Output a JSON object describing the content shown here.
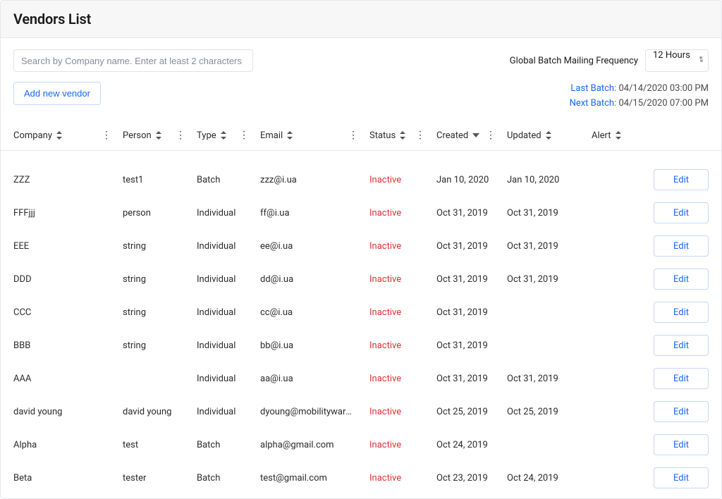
{
  "header": {
    "title": "Vendors List"
  },
  "search": {
    "placeholder": "Search by Company name. Enter at least 2 characters"
  },
  "frequency": {
    "label": "Global Batch Mailing Frequency",
    "value": "12 Hours"
  },
  "add_button": "Add new vendor",
  "batch": {
    "last_label": "Last Batch:",
    "last_value": "04/14/2020 03:00 PM",
    "next_label": "Next Batch:",
    "next_value": "04/15/2020 07:00 PM"
  },
  "columns": {
    "company": "Company",
    "person": "Person",
    "type": "Type",
    "email": "Email",
    "status": "Status",
    "created": "Created",
    "updated": "Updated",
    "alert": "Alert"
  },
  "edit_label": "Edit",
  "rows": [
    {
      "company": "ZZZ",
      "person": "test1",
      "type": "Batch",
      "email": "zzz@i.ua",
      "status": "Inactive",
      "created": "Jan 10, 2020",
      "updated": "Jan 10, 2020"
    },
    {
      "company": "FFFjjj",
      "person": "person",
      "type": "Individual",
      "email": "ff@i.ua",
      "status": "Inactive",
      "created": "Oct 31, 2019",
      "updated": "Oct 31, 2019"
    },
    {
      "company": "EEE",
      "person": "string",
      "type": "Individual",
      "email": "ee@i.ua",
      "status": "Inactive",
      "created": "Oct 31, 2019",
      "updated": "Oct 31, 2019"
    },
    {
      "company": "DDD",
      "person": "string",
      "type": "Individual",
      "email": "dd@i.ua",
      "status": "Inactive",
      "created": "Oct 31, 2019",
      "updated": "Oct 31, 2019"
    },
    {
      "company": "CCC",
      "person": "string",
      "type": "Individual",
      "email": "cc@i.ua",
      "status": "Inactive",
      "created": "Oct 31, 2019",
      "updated": ""
    },
    {
      "company": "BBB",
      "person": "string",
      "type": "Individual",
      "email": "bb@i.ua",
      "status": "Inactive",
      "created": "Oct 31, 2019",
      "updated": ""
    },
    {
      "company": "AAA",
      "person": "",
      "type": "Individual",
      "email": "aa@i.ua",
      "status": "Inactive",
      "created": "Oct 31, 2019",
      "updated": "Oct 31, 2019"
    },
    {
      "company": "david young",
      "person": "david young",
      "type": "Individual",
      "email": "dyoung@mobilityware.c...",
      "status": "Inactive",
      "created": "Oct 25, 2019",
      "updated": "Oct 25, 2019"
    },
    {
      "company": "Alpha",
      "person": "test",
      "type": "Batch",
      "email": "alpha@gmail.com",
      "status": "Inactive",
      "created": "Oct 24, 2019",
      "updated": ""
    },
    {
      "company": "Beta",
      "person": "tester",
      "type": "Batch",
      "email": "test@gmail.com",
      "status": "Inactive",
      "created": "Oct 23, 2019",
      "updated": "Oct 24, 2019"
    }
  ]
}
